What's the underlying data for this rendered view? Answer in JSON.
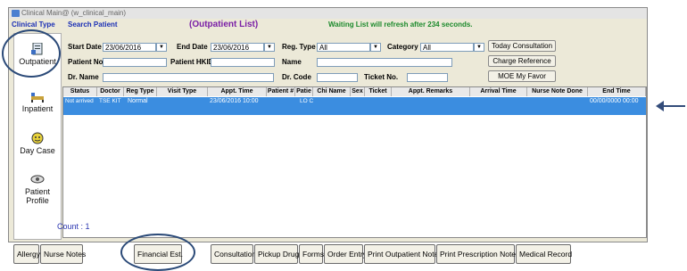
{
  "window": {
    "title": "Clinical Main@ (w_clinical_main)"
  },
  "header": {
    "clinical_type": "Clinical Type",
    "search_patient": "Search Patient",
    "title": "(Outpatient List)",
    "refresh_notice": "Waiting List will refresh after 234 seconds."
  },
  "filters": {
    "start_date_label": "Start Date",
    "start_date_value": "23/06/2016",
    "end_date_label": "End Date",
    "end_date_value": "23/06/2016",
    "reg_type_label": "Reg. Type",
    "reg_type_value": "All",
    "category_label": "Category",
    "category_value": "All",
    "patient_no_label": "Patient No.",
    "patient_hkid_label": "Patient HKID",
    "name_label": "Name",
    "dr_name_label": "Dr. Name",
    "dr_code_label": "Dr. Code",
    "ticket_no_label": "Ticket No."
  },
  "right_buttons": {
    "today_consultation": "Today Consultation",
    "charge_reference": "Charge Reference",
    "moe_my_favor": "MOE My Favor"
  },
  "sidebar": {
    "items": [
      {
        "label": "Outpatient",
        "icon": "outpatient-icon"
      },
      {
        "label": "Inpatient",
        "icon": "inpatient-icon"
      },
      {
        "label": "Day Case",
        "icon": "day-case-icon"
      },
      {
        "label": "Patient Profile",
        "icon": "patient-profile-icon"
      }
    ]
  },
  "table": {
    "columns": [
      "Status",
      "Doctor",
      "Reg Type",
      "Visit Type",
      "Appt. Time",
      "Patient #",
      "Patie",
      "Chi Name",
      "Sex",
      "Ticket",
      "Appt. Remarks",
      "Arrival Time",
      "Nurse Note Done",
      "End Time"
    ],
    "rows": [
      {
        "status": "Not arrived",
        "doctor": "TSE KIT",
        "reg_type": "Normal",
        "visit_type": "",
        "appt_time": "23/06/2016 10:00",
        "patient_name": "LO C",
        "end_time": "00/00/0000 00:00"
      }
    ]
  },
  "count_text": "Count : 1",
  "bottom_buttons": {
    "allergy": "Allergy",
    "nurse_notes": "Nurse Notes",
    "financial_est": "Financial Est.",
    "consultation": "Consultation",
    "pickup_drug": "Pickup Drug",
    "forms": "Forms",
    "order_entry": "Order Entry",
    "print_outpatient_notes": "Print Outpatient Notes",
    "print_prescription_notes": "Print Prescription Notes",
    "medical_record": "Medical Record"
  },
  "colors": {
    "selected_row": "#3b8de0",
    "title_purple": "#7a1fa6",
    "header_blue": "#1a2fb5",
    "refresh_green": "#1c8a2c",
    "annotation": "#2b4a78"
  }
}
